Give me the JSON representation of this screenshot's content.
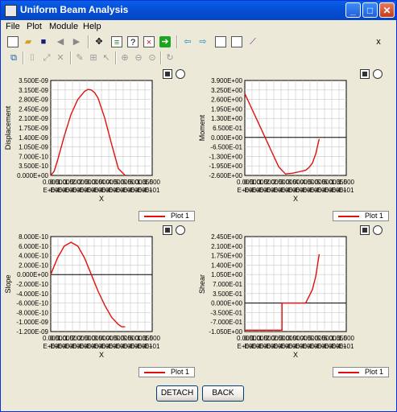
{
  "window": {
    "title": "Uniform Beam Analysis"
  },
  "title_buttons": {
    "minimize": "_",
    "maximize": "□",
    "close": "✕"
  },
  "menu": [
    "File",
    "Plot",
    "Module",
    "Help"
  ],
  "toolbar1_icons": [
    "new-file-icon",
    "open-folder-icon",
    "save-icon",
    "back-arrow-icon",
    "forward-arrow-icon",
    "move-icon",
    "calculator-icon",
    "help-document-icon",
    "delete-document-icon",
    "run-icon",
    "left-arrow-icon",
    "right-arrow-icon",
    "document-icon",
    "copy-document-icon",
    "chart-icon"
  ],
  "toolbar2_icons": [
    "paste-icon",
    "crop-icon",
    "expand-icon",
    "delete-icon",
    "edit-icon",
    "select-icon",
    "pointer-icon",
    "zoom-in-icon",
    "zoom-out-icon",
    "zoom-fit-icon",
    "refresh-icon"
  ],
  "close_x": "x",
  "legend_label": "Plot 1",
  "x_tick_labels": [
    "0.000",
    "E+00",
    "0.500",
    "E+00",
    "1.000",
    "E+00",
    "1.500",
    "E+00",
    "2.000",
    "E+00",
    "2.500",
    "E+00",
    "3.000",
    "E+00",
    "3.500",
    "E+00",
    "4.000",
    "E+00",
    "4.500",
    "E+00",
    "5.000",
    "E+00",
    "5.500",
    "E+00",
    "6.000",
    "E+00",
    "1.350",
    "E+01",
    "1.500",
    "E+01"
  ],
  "buttons": {
    "detach": "DETACH",
    "back": "BACK"
  },
  "colors": {
    "series": "#e01010",
    "grid": "#c8c8c8",
    "plot_bg": "#ffffff",
    "panel_bg": "#ece9d8"
  },
  "chart_data": [
    {
      "type": "line",
      "xlabel": "X",
      "ylabel": "Displacement",
      "grid": true,
      "legend": "bottom-right",
      "x_tick_labels": [
        "0.000\nE+00",
        "0.500\nE+00",
        "1.000\nE+00",
        "1.500\nE+00",
        "2.000\nE+00",
        "2.500\nE+00",
        "3.000\nE+00",
        "3.500\nE+00",
        "4.000\nE+00",
        "4.500\nE+00",
        "5.000\nE+00",
        "5.500\nE+00",
        "6.000\nE+00",
        "1.350\nE+01",
        "1.500\nE+01"
      ],
      "y_tick_labels": [
        "0.000E+00",
        "3.500E-10",
        "7.000E-10",
        "1.050E-09",
        "1.400E-09",
        "1.750E-09",
        "2.100E-09",
        "2.450E-09",
        "2.800E-09",
        "3.150E-09",
        "3.500E-09"
      ],
      "ylim": [
        0,
        3.5e-09
      ],
      "xlim": [
        0,
        1.5
      ],
      "zero_line": false,
      "series": [
        {
          "name": "Plot 1",
          "x": [
            0,
            0.05,
            0.1,
            0.2,
            0.3,
            0.4,
            0.5,
            0.55,
            0.6,
            0.65,
            0.7,
            0.8,
            0.9,
            1.0,
            1.1
          ],
          "y": [
            0,
            1.5e-10,
            5.5e-10,
            1.45e-09,
            2.25e-09,
            2.8e-09,
            3.1e-09,
            3.17e-09,
            3.15e-09,
            3.05e-09,
            2.85e-09,
            2.1e-09,
            1.15e-09,
            2.5e-10,
            0
          ]
        }
      ]
    },
    {
      "type": "line",
      "xlabel": "X",
      "ylabel": "Moment",
      "grid": true,
      "legend": "bottom-right",
      "x_tick_labels": [
        "0.000\nE+00",
        "0.500\nE+00",
        "1.000\nE+00",
        "1.500\nE+00",
        "2.000\nE+00",
        "2.500\nE+00",
        "3.000\nE+00",
        "3.500\nE+00",
        "4.000\nE+00",
        "4.500\nE+00",
        "5.000\nE+00",
        "5.500\nE+00",
        "6.000\nE+00",
        "1.350\nE+01",
        "1.500\nE+01"
      ],
      "y_tick_labels": [
        "-2.600E+00",
        "-1.950E+00",
        "-1.300E+00",
        "-6.500E-01",
        "0.000E+00",
        "6.500E-01",
        "1.300E+00",
        "1.950E+00",
        "2.600E+00",
        "3.250E+00",
        "3.900E+00"
      ],
      "ylim": [
        -2.6,
        3.9
      ],
      "xlim": [
        0,
        1.5
      ],
      "zero_line": true,
      "series": [
        {
          "name": "Plot 1",
          "x": [
            0,
            0.1,
            0.2,
            0.3,
            0.4,
            0.5,
            0.6,
            0.7,
            0.8,
            0.9,
            0.95,
            1.0,
            1.05,
            1.1
          ],
          "y": [
            3.0,
            2.0,
            1.0,
            0.0,
            -1.0,
            -2.0,
            -2.5,
            -2.45,
            -2.35,
            -2.25,
            -2.05,
            -1.75,
            -1.1,
            -0.1
          ]
        }
      ]
    },
    {
      "type": "line",
      "xlabel": "X",
      "ylabel": "Slope",
      "grid": true,
      "legend": "bottom-right",
      "x_tick_labels": [
        "0.000\nE+00",
        "0.500\nE+00",
        "1.000\nE+00",
        "1.500\nE+00",
        "2.000\nE+00",
        "2.500\nE+00",
        "3.000\nE+00",
        "3.500\nE+00",
        "4.000\nE+00",
        "4.500\nE+00",
        "5.000\nE+00",
        "5.500\nE+00",
        "6.000\nE+00",
        "1.350\nE+01",
        "1.500\nE+01"
      ],
      "y_tick_labels": [
        "-1.200E-09",
        "-1.000E-09",
        "-8.000E-10",
        "-6.000E-10",
        "-4.000E-10",
        "-2.000E-10",
        "0.000E+00",
        "2.000E-10",
        "4.000E-10",
        "6.000E-10",
        "8.000E-10"
      ],
      "ylim": [
        -1.2e-09,
        8e-10
      ],
      "xlim": [
        0,
        1.5
      ],
      "zero_line": true,
      "series": [
        {
          "name": "Plot 1",
          "x": [
            0,
            0.1,
            0.2,
            0.3,
            0.4,
            0.5,
            0.6,
            0.7,
            0.8,
            0.9,
            1.0,
            1.05,
            1.1
          ],
          "y": [
            0,
            3.5e-10,
            6e-10,
            6.8e-10,
            6e-10,
            3.5e-10,
            0,
            -3.5e-10,
            -6.5e-10,
            -9e-10,
            -1.05e-09,
            -1.1e-09,
            -1.1e-09
          ]
        }
      ]
    },
    {
      "type": "line",
      "xlabel": "X",
      "ylabel": "Shear",
      "grid": true,
      "legend": "bottom-right",
      "x_tick_labels": [
        "0.000\nE+00",
        "0.500\nE+00",
        "1.000\nE+00",
        "1.500\nE+00",
        "2.000\nE+00",
        "2.500\nE+00",
        "3.000\nE+00",
        "3.500\nE+00",
        "4.000\nE+00",
        "4.500\nE+00",
        "5.000\nE+00",
        "5.500\nE+00",
        "6.000\nE+00",
        "1.350\nE+01",
        "1.500\nE+01"
      ],
      "y_tick_labels": [
        "-1.050E+00",
        "-7.000E-01",
        "-3.500E-01",
        "0.000E+00",
        "3.500E-01",
        "7.000E-01",
        "1.050E+00",
        "1.400E+00",
        "1.750E+00",
        "2.100E+00",
        "2.450E+00"
      ],
      "ylim": [
        -1.05,
        2.45
      ],
      "xlim": [
        0,
        1.5
      ],
      "zero_line": true,
      "series": [
        {
          "name": "Plot 1",
          "x": [
            0,
            0.55,
            0.55,
            0.9,
            1.0,
            1.05,
            1.1
          ],
          "y": [
            -1.0,
            -1.0,
            0.0,
            0.0,
            0.5,
            1.0,
            1.8
          ]
        }
      ]
    }
  ]
}
